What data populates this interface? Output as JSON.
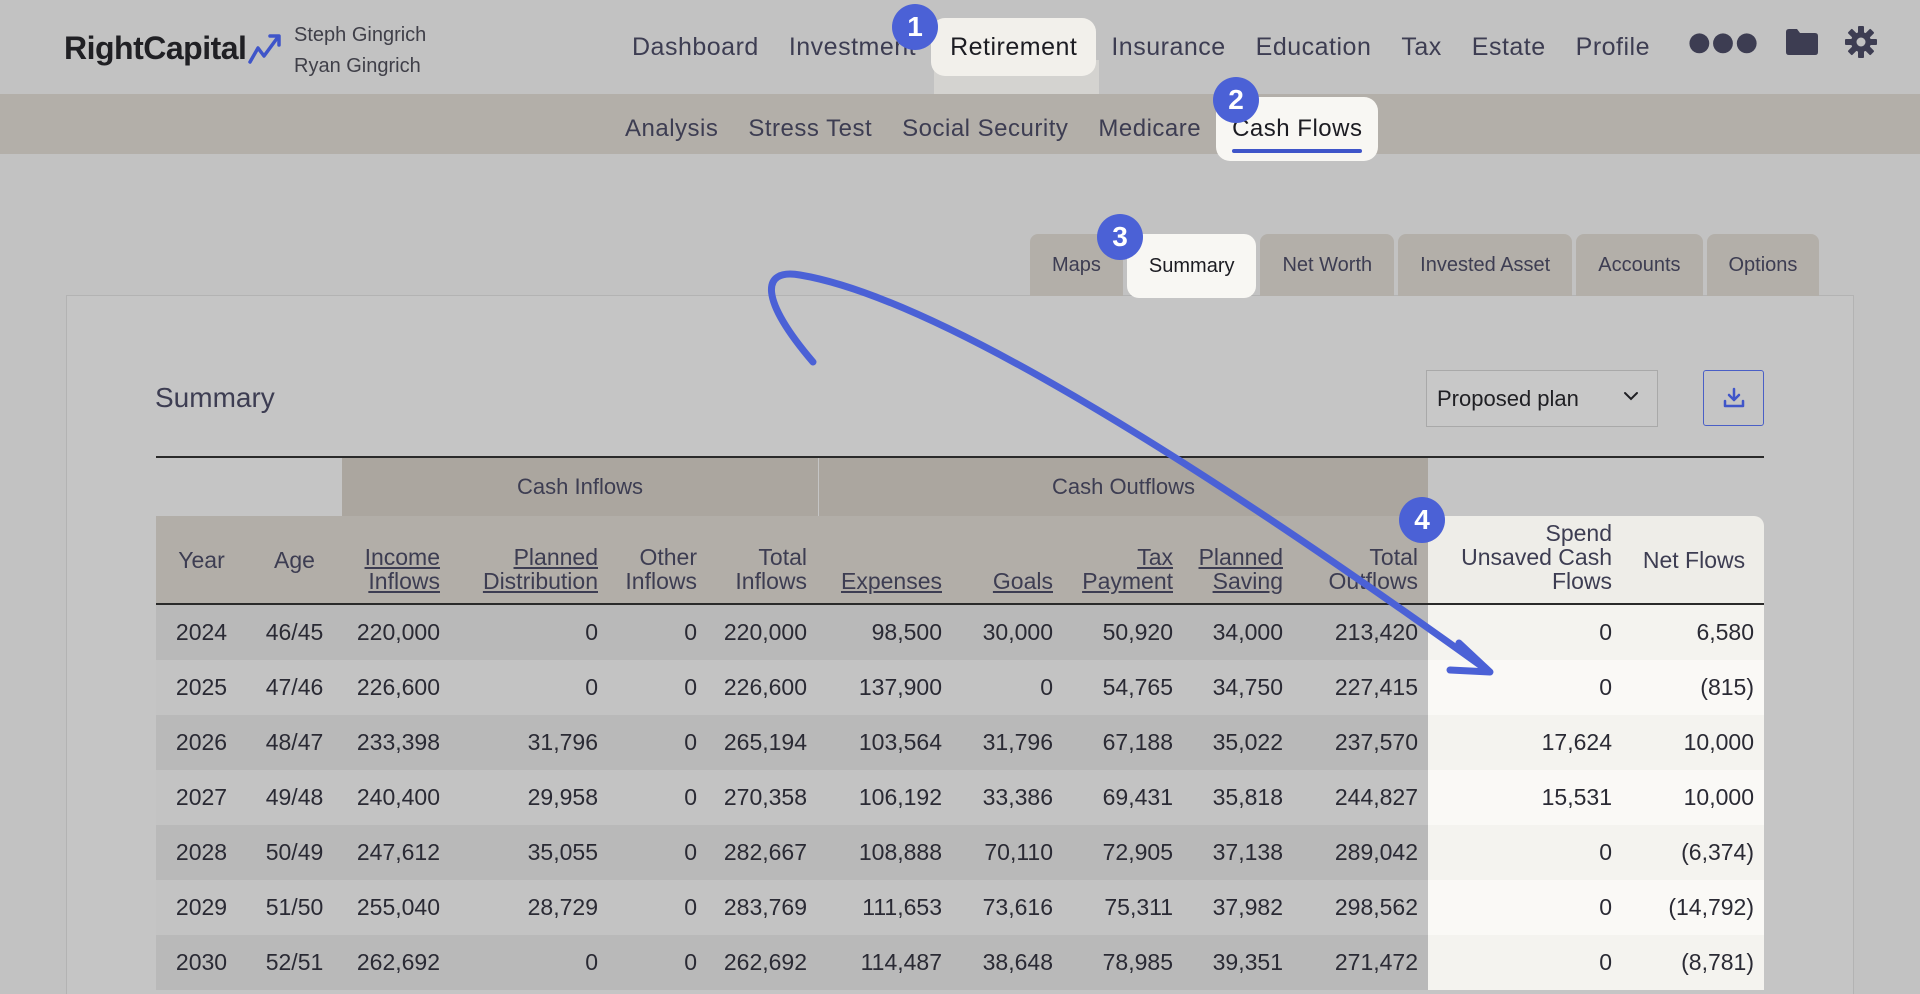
{
  "brand": {
    "name": "RightCapital"
  },
  "clients": [
    "Steph Gingrich",
    "Ryan Gingrich"
  ],
  "main_nav": [
    "Dashboard",
    "Investment",
    "Retirement",
    "Insurance",
    "Education",
    "Tax",
    "Estate",
    "Profile"
  ],
  "main_nav_active": "Retirement",
  "sub_nav": [
    "Analysis",
    "Stress Test",
    "Social Security",
    "Medicare",
    "Cash Flows"
  ],
  "sub_nav_active": "Cash Flows",
  "panel_tabs": [
    "Maps",
    "Summary",
    "Net Worth",
    "Invested Asset",
    "Accounts",
    "Options"
  ],
  "panel_tab_active": "Summary",
  "summary": {
    "title": "Summary",
    "plan_select": "Proposed plan"
  },
  "table": {
    "groups": [
      "Cash Inflows",
      "Cash Outflows"
    ],
    "columns": [
      {
        "l1": "",
        "l2": "Year",
        "link": false
      },
      {
        "l1": "",
        "l2": "Age",
        "link": false
      },
      {
        "l1": "Income",
        "l2": "Inflows",
        "link": true
      },
      {
        "l1": "Planned",
        "l2": "Distribution",
        "link": true
      },
      {
        "l1": "Other",
        "l2": "Inflows",
        "link": false
      },
      {
        "l1": "Total",
        "l2": "Inflows",
        "link": false
      },
      {
        "l1": "",
        "l2": "Expenses",
        "link": true
      },
      {
        "l1": "",
        "l2": "Goals",
        "link": true
      },
      {
        "l1": "Tax",
        "l2": "Payment",
        "link": true
      },
      {
        "l1": "Planned",
        "l2": "Saving",
        "link": true
      },
      {
        "l1": "Total",
        "l2": "Outflows",
        "link": false
      },
      {
        "l1": "Spend",
        "l1b": "Unsaved Cash",
        "l2": "Flows",
        "link": false
      },
      {
        "l1": "",
        "l2": "Net Flows",
        "link": false
      }
    ],
    "rows": [
      [
        "2024",
        "46/45",
        "220,000",
        "0",
        "0",
        "220,000",
        "98,500",
        "30,000",
        "50,920",
        "34,000",
        "213,420",
        "0",
        "6,580"
      ],
      [
        "2025",
        "47/46",
        "226,600",
        "0",
        "0",
        "226,600",
        "137,900",
        "0",
        "54,765",
        "34,750",
        "227,415",
        "0",
        "(815)"
      ],
      [
        "2026",
        "48/47",
        "233,398",
        "31,796",
        "0",
        "265,194",
        "103,564",
        "31,796",
        "67,188",
        "35,022",
        "237,570",
        "17,624",
        "10,000"
      ],
      [
        "2027",
        "49/48",
        "240,400",
        "29,958",
        "0",
        "270,358",
        "106,192",
        "33,386",
        "69,431",
        "35,818",
        "244,827",
        "15,531",
        "10,000"
      ],
      [
        "2028",
        "50/49",
        "247,612",
        "35,055",
        "0",
        "282,667",
        "108,888",
        "70,110",
        "72,905",
        "37,138",
        "289,042",
        "0",
        "(6,374)"
      ],
      [
        "2029",
        "51/50",
        "255,040",
        "28,729",
        "0",
        "283,769",
        "111,653",
        "73,616",
        "75,311",
        "37,982",
        "298,562",
        "0",
        "(14,792)"
      ],
      [
        "2030",
        "52/51",
        "262,692",
        "0",
        "0",
        "262,692",
        "114,487",
        "38,648",
        "78,985",
        "39,351",
        "271,472",
        "0",
        "(8,781)"
      ]
    ]
  },
  "annotations": [
    "1",
    "2",
    "3",
    "4"
  ],
  "colors": {
    "accent": "#4b61d6",
    "active_tab_bg": "#f2f0eb",
    "page_bg": "#c2c2c2"
  },
  "icons": {
    "more": "more-icon",
    "folder": "folder-icon",
    "settings": "gear-icon",
    "download": "download-icon",
    "chevron": "chevron-down-icon"
  }
}
